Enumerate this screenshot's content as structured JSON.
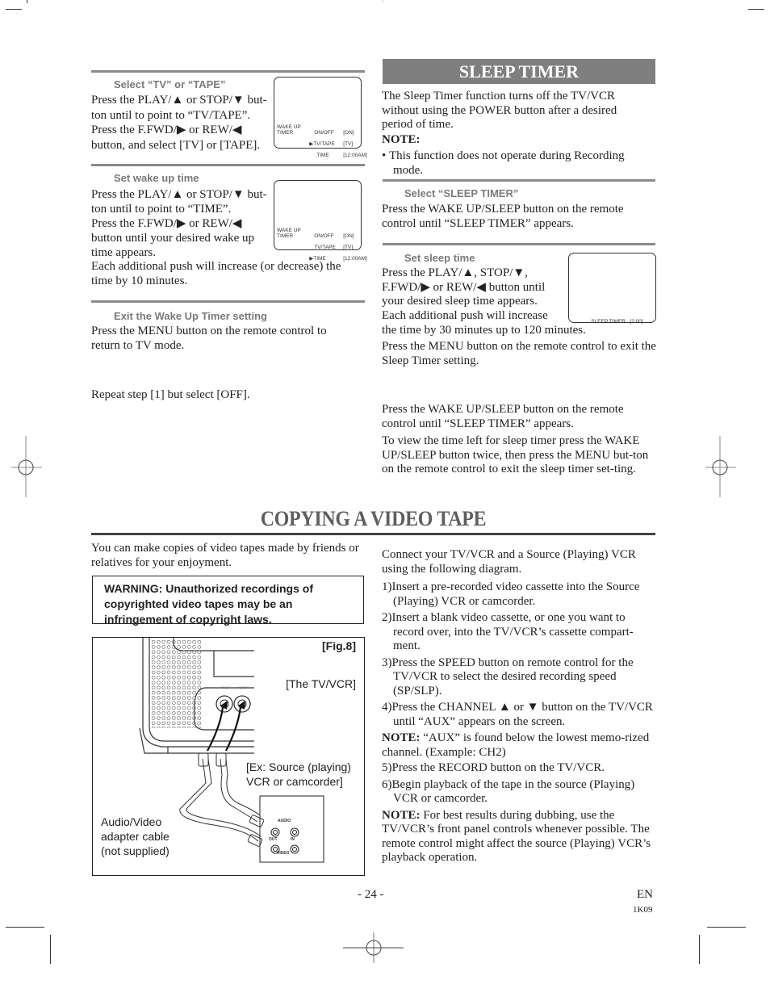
{
  "left_column": {
    "step_select_tv_tape": {
      "heading": "Select “TV” or “TAPE”",
      "lines": [
        "Press the PLAY/▲ or STOP/▼ but-",
        "ton until to point to “TV/TAPE”.",
        "Press the F.FWD/▶ or REW/◀",
        "button, and select [TV] or [TAPE]."
      ],
      "osd": {
        "title1": "WAKE UP",
        "title2": "TIMER",
        "row1": "ON/OFF",
        "row2": "TV/TAPE",
        "row3": "TIME",
        "val1": "[ON]",
        "val2": "[TV]",
        "val3": "[12:00AM]",
        "cursor": "▶"
      }
    },
    "step_set_wake_time": {
      "heading": "Set wake up time",
      "lines": [
        "Press the PLAY/▲ or STOP/▼ but-",
        "ton until to point to “TIME”.",
        "Press the F.FWD/▶ or REW/◀",
        "button until your desired wake up",
        "time appears."
      ],
      "extra": "Each additional push will increase (or decrease) the time by 10 minutes.",
      "osd": {
        "title1": "WAKE UP",
        "title2": "TIMER",
        "row1": "ON/OFF",
        "row2": "TV/TAPE",
        "row3": "TIME",
        "val1": "[ON]",
        "val2": "[TV]",
        "val3": "[12:00AM]",
        "cursor": "▶"
      }
    },
    "step_exit": {
      "heading": "Exit the Wake Up Timer setting",
      "text": "Press the MENU button on the remote control to return to TV mode."
    },
    "cancel_text": "Repeat step [1] but select [OFF]."
  },
  "sleep_timer": {
    "title": "SLEEP TIMER",
    "intro": "The Sleep Timer function turns off the TV/VCR without using the POWER button after a desired period of time.",
    "note_label": "NOTE:",
    "note_bullet": "This function does not operate during Recording mode.",
    "step_select": {
      "heading": "Select “SLEEP TIMER”",
      "text": "Press the WAKE UP/SLEEP button on the remote control until “SLEEP TIMER” appears."
    },
    "step_set": {
      "heading": "Set sleep time",
      "lines": [
        "Press the PLAY/▲, STOP/▼,",
        "F.FWD/▶ or REW/◀ button until",
        "your desired sleep time appears.",
        "Each additional push will increase"
      ],
      "cont": "the time by 30 minutes up to 120 minutes.",
      "exit": "Press the MENU button on the remote control to exit the Sleep Timer setting.",
      "osd_label": "SLEEP TIMER",
      "osd_value": "[2:00]"
    },
    "cancel_text": "Press the WAKE UP/SLEEP button on the remote control until “SLEEP TIMER” appears.",
    "view_text": "To view the time left for sleep timer press the WAKE UP/SLEEP button twice, then press the MENU but-ton on the remote control to exit the sleep timer set-ting."
  },
  "copying": {
    "title": "COPYING A VIDEO TAPE",
    "intro": "You can make copies of video tapes made by friends or relatives for your enjoyment.",
    "warning": "WARNING: Unauthorized recordings of copyrighted video tapes may be an infringement of copyright laws.",
    "figure": {
      "label": "[Fig.8]",
      "tv_label": "[The TV/VCR]",
      "source_label_1": "[Ex: Source (playing)",
      "source_label_2": "VCR or camcorder]",
      "cable_label_1": "Audio/Video",
      "cable_label_2": "adapter cable",
      "cable_label_3": "(not supplied)",
      "jack_video": "VIDEO",
      "jack_audio": "AUDIO",
      "panel_audio": "AUDIO",
      "panel_out": "OUT",
      "panel_in": "IN",
      "panel_video": "VIDEO"
    },
    "connect": "Connect your TV/VCR and a Source (Playing) VCR using the following diagram.",
    "steps": [
      "1)Insert a pre-recorded video cassette into the Source (Playing) VCR or camcorder.",
      "2)Insert a blank video cassette, or one you want to record over, into the TV/VCR’s cassette compart-ment.",
      "3)Press the SPEED button on remote control for the TV/VCR to select the desired recording speed (SP/SLP).",
      "4)Press the CHANNEL ▲ or ▼ button on the TV/VCR until “AUX” appears on the screen."
    ],
    "note1_label": "NOTE:",
    "note1_text": " “AUX” is found below the lowest memo-rized channel. (Example: CH2)",
    "steps2": [
      "5)Press the RECORD button on the TV/VCR.",
      "6)Begin playback of the tape in the source (Playing) VCR or camcorder."
    ],
    "note2_label": "NOTE:",
    "note2_text": " For best results during dubbing, use the TV/VCR’s front panel controls whenever possible. The remote control might affect the source (Playing) VCR’s playback operation."
  },
  "footer": {
    "page_number": "- 24 -",
    "lang": "EN",
    "code": "1K09"
  }
}
